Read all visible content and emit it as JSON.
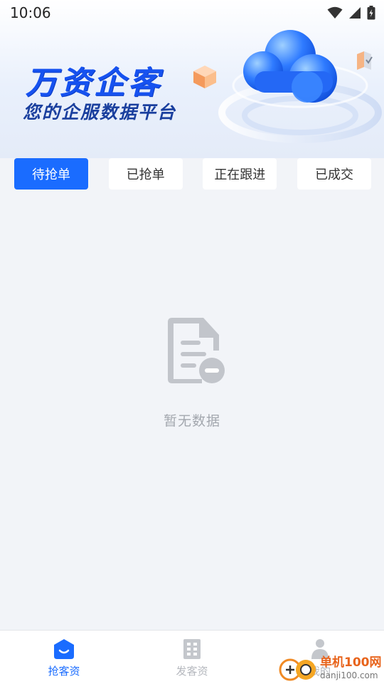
{
  "status_bar": {
    "time": "10:06",
    "icons": [
      "wifi-icon",
      "signal-icon",
      "battery-icon"
    ]
  },
  "banner": {
    "title": "万资企客",
    "subtitle": "您的企服数据平台"
  },
  "tabs": [
    {
      "label": "待抢单",
      "active": true
    },
    {
      "label": "已抢单",
      "active": false
    },
    {
      "label": "正在跟进",
      "active": false
    },
    {
      "label": "已成交",
      "active": false
    }
  ],
  "empty_state": {
    "icon": "document-remove-icon",
    "text": "暂无数据"
  },
  "bottom_nav": [
    {
      "label": "抢客资",
      "icon": "home-icon",
      "active": true
    },
    {
      "label": "发客资",
      "icon": "building-icon",
      "active": false
    },
    {
      "label": "我的",
      "icon": "person-icon",
      "active": false
    }
  ],
  "watermark": {
    "name": "单机100网",
    "url": "danji100.com"
  },
  "colors": {
    "accent": "#1a6cff",
    "brand_title": "#1652f0",
    "background": "#f2f4f8",
    "inactive": "#b5b8be"
  }
}
